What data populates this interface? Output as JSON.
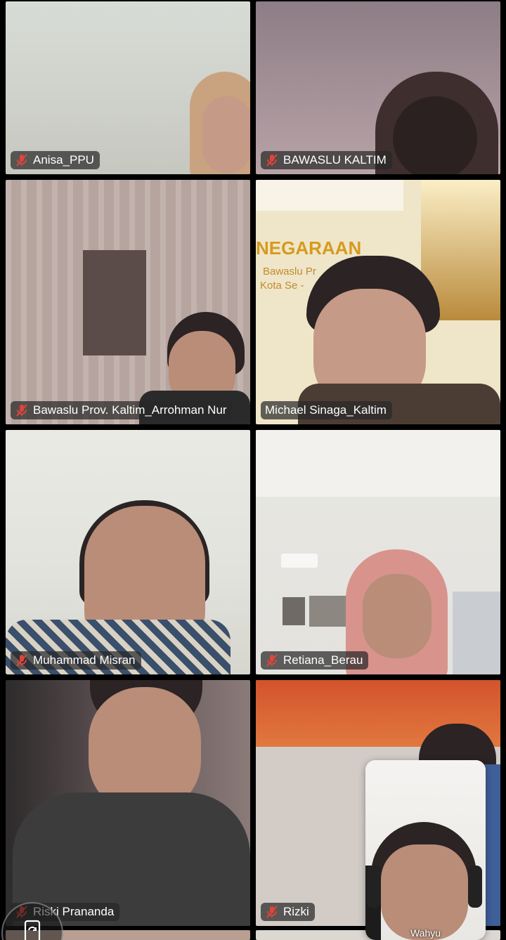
{
  "participants": [
    {
      "name": "Anisa_PPU",
      "muted": true
    },
    {
      "name": "BAWASLU KALTIM",
      "muted": true
    },
    {
      "name": "Bawaslu Prov. Kaltim_Arrohman Nur",
      "muted": true
    },
    {
      "name": "Michael Sinaga_Kaltim",
      "muted": false
    },
    {
      "name": "Muhammad Misran",
      "muted": true
    },
    {
      "name": "Retiana_Berau",
      "muted": true
    },
    {
      "name": "Riski Prananda",
      "muted": true
    },
    {
      "name": "Rizki",
      "muted": true
    }
  ],
  "banner": {
    "line1": "NEGARAAN",
    "line2": "Bawaslu Pr",
    "line3": "Kota Se -"
  },
  "self_view": {
    "name": "Wahyu"
  },
  "icons": {
    "muted_mic": "mic-off-icon",
    "camera_switch": "camera-rotate-icon"
  },
  "colors": {
    "background": "#000000",
    "muted_icon": "#e0453a",
    "name_tag_bg": "#282828"
  }
}
